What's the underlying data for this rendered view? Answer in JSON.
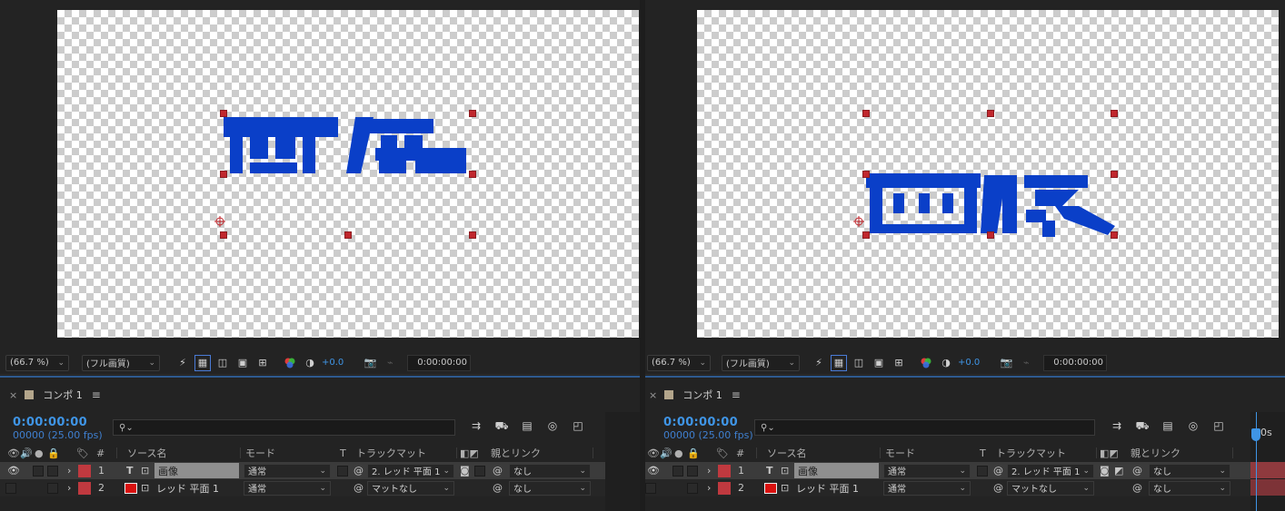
{
  "panels": [
    {
      "id": "left",
      "viewer": {
        "text_preview": "画像",
        "zoom": "(66.7 %)",
        "resolution": "(フル画質)",
        "exposure": "+0.0",
        "timecode": "0:00:00:00"
      },
      "timeline": {
        "comp_tab": "コンポ 1",
        "current_time": "0:00:00:00",
        "frames": "00000 (25.00 fps)",
        "search_placeholder": "",
        "columns": {
          "number": "#",
          "source_name": "ソース名",
          "mode": "モード",
          "t": "T",
          "track_matte": "トラックマット",
          "parent": "親とリンク"
        },
        "layers": [
          {
            "index": "1",
            "type_icon": "T",
            "name": "画像",
            "mode": "通常",
            "track_matte": "2. レッド 平面 1",
            "parent": "なし"
          },
          {
            "index": "2",
            "type_icon": "solid",
            "name": "レッド 平面 1",
            "mode": "通常",
            "track_matte": "マットなし",
            "parent": "なし"
          }
        ],
        "ruler_label": ""
      }
    },
    {
      "id": "right",
      "viewer": {
        "text_preview": "画像",
        "zoom": "(66.7 %)",
        "resolution": "(フル画質)",
        "exposure": "+0.0",
        "timecode": "0:00:00:00"
      },
      "timeline": {
        "comp_tab": "コンポ 1",
        "current_time": "0:00:00:00",
        "frames": "00000 (25.00 fps)",
        "search_placeholder": "",
        "columns": {
          "number": "#",
          "source_name": "ソース名",
          "mode": "モード",
          "t": "T",
          "track_matte": "トラックマット",
          "parent": "親とリンク"
        },
        "layers": [
          {
            "index": "1",
            "type_icon": "T",
            "name": "画像",
            "mode": "通常",
            "track_matte": "2. レッド 平面 1",
            "parent": "なし"
          },
          {
            "index": "2",
            "type_icon": "solid",
            "name": "レッド 平面 1",
            "mode": "通常",
            "track_matte": "マットなし",
            "parent": "なし"
          }
        ],
        "ruler_label": "00s"
      }
    }
  ],
  "colors": {
    "text_fill": "#0a3fc8",
    "handle": "#c0272d",
    "accent_blue": "#3f95e6",
    "layer_label_red": "#c0393f"
  },
  "icons": [
    "close-icon",
    "comp-swatch-icon",
    "menu-icon",
    "search-icon",
    "eye-icon",
    "audio-icon",
    "solo-icon",
    "lock-icon",
    "label-tag-icon",
    "expand-chevron-icon",
    "text-layer-icon",
    "solid-layer-icon",
    "spiral-pickwhip-icon",
    "camera-icon",
    "color-channels-icon",
    "exposure-icon"
  ]
}
